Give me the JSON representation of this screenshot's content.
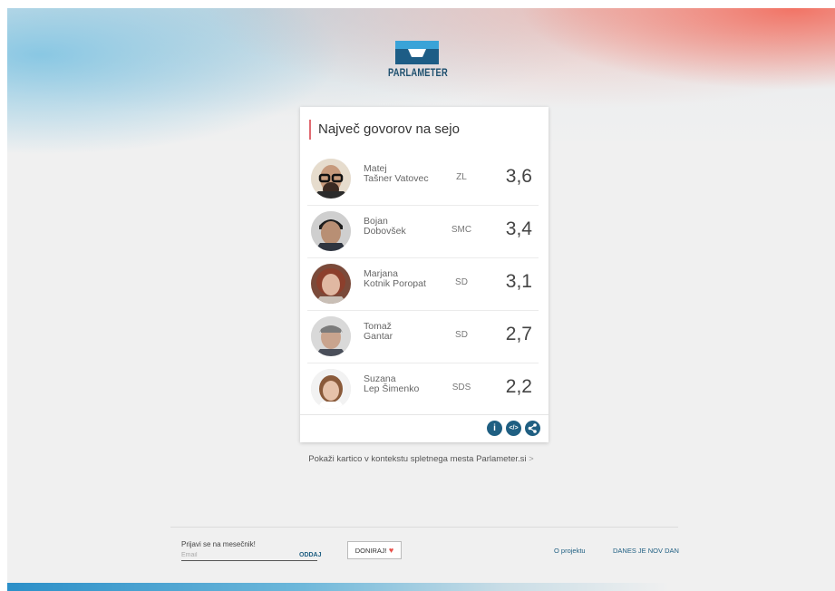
{
  "header": {
    "logo_text": "PARLAMETER"
  },
  "card": {
    "title": "Največ govorov na sejo",
    "rows": [
      {
        "first_name": "Matej",
        "last_name": "Tašner Vatovec",
        "party": "ZL",
        "value": "3,6"
      },
      {
        "first_name": "Bojan",
        "last_name": "Dobovšek",
        "party": "SMC",
        "value": "3,4"
      },
      {
        "first_name": "Marjana",
        "last_name": "Kotnik Poropat",
        "party": "SD",
        "value": "3,1"
      },
      {
        "first_name": "Tomaž",
        "last_name": "Gantar",
        "party": "SD",
        "value": "2,7"
      },
      {
        "first_name": "Suzana",
        "last_name": "Lep Šimenko",
        "party": "SDS",
        "value": "2,2"
      }
    ],
    "footer_buttons": {
      "info": "i",
      "embed": "</>",
      "share_icon": "share-icon"
    }
  },
  "context_link": "Pokaži kartico v kontekstu spletnega mesta Parlameter.si",
  "footer": {
    "newsletter_label": "Prijavi se na mesečnik!",
    "email_placeholder": "Email",
    "submit_label": "ODDAJ",
    "donate_label": "DONIRAJ!",
    "about_label": "O projektu",
    "today_label": "DANES JE NOV DAN"
  },
  "colors": {
    "accent": "#1f5f82",
    "title_bar": "#e06b72",
    "heart": "#e8504a"
  }
}
